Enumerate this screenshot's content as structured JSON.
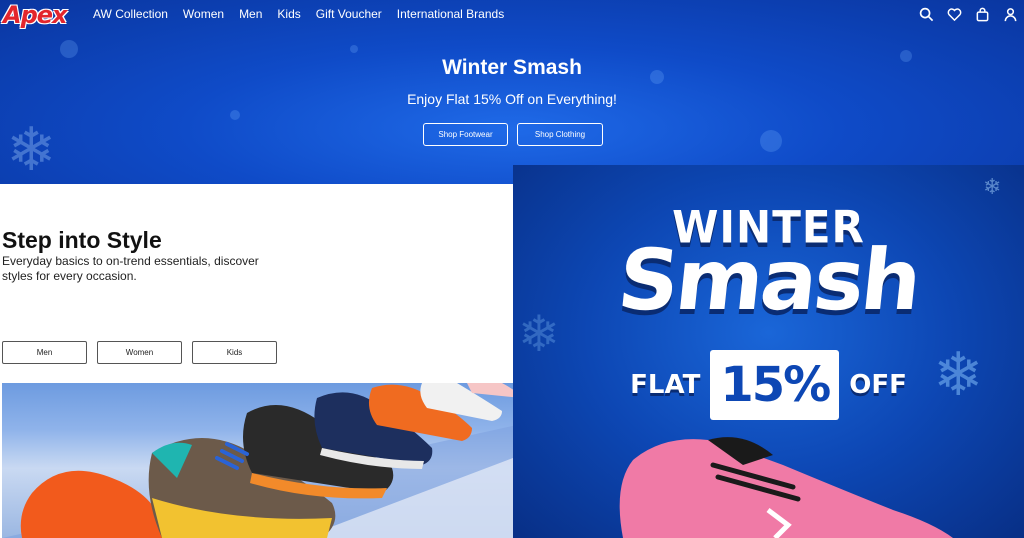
{
  "header": {
    "logo_text": "Apex",
    "nav": [
      {
        "label": "AW Collection"
      },
      {
        "label": "Women"
      },
      {
        "label": "Men"
      },
      {
        "label": "Kids"
      },
      {
        "label": "Gift Voucher"
      },
      {
        "label": "International Brands"
      }
    ],
    "icons": [
      "search-icon",
      "heart-icon",
      "bag-icon",
      "user-icon"
    ]
  },
  "hero": {
    "title": "Winter Smash",
    "subtitle": "Enjoy Flat 15% Off on Everything!",
    "buttons": [
      {
        "label": "Shop Footwear"
      },
      {
        "label": "Shop Clothing"
      }
    ]
  },
  "style_section": {
    "title": "Step into Style",
    "description": "Everyday basics to on-trend essentials, discover styles for every occasion.",
    "buttons": [
      {
        "label": "Men"
      },
      {
        "label": "Women"
      },
      {
        "label": "Kids"
      }
    ]
  },
  "promo": {
    "line1": "WINTER",
    "line2": "Smash",
    "flat": "FLAT",
    "percent": "15%",
    "off": "OFF"
  },
  "colors": {
    "hero_blue": "#0f4bc8",
    "logo_red": "#e3262d",
    "promo_blue": "#0d47b4"
  }
}
